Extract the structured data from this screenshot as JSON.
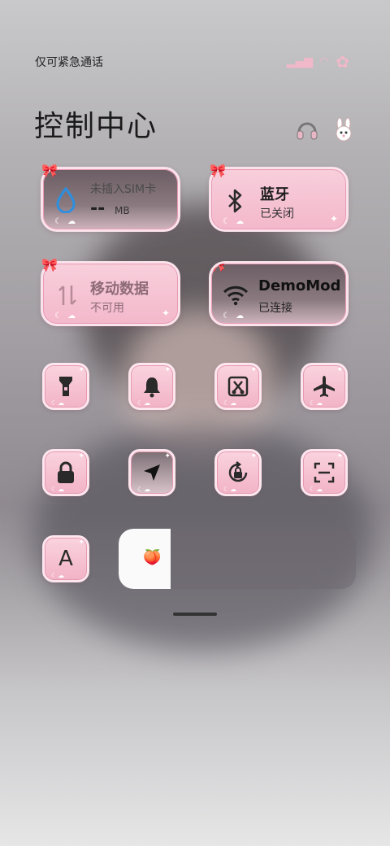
{
  "status": {
    "carrier_text": "仅可紧急通话"
  },
  "header": {
    "title": "控制中心"
  },
  "tiles": {
    "data_usage": {
      "title": "未插入SIM卡",
      "value": "--",
      "unit": "MB"
    },
    "bluetooth": {
      "title": "蓝牙",
      "status": "已关闭"
    },
    "mobile_data": {
      "title": "移动数据",
      "status": "不可用"
    },
    "wifi": {
      "title": "DemoMod",
      "status": "已连接"
    }
  },
  "quick_toggles": [
    {
      "name": "flashlight"
    },
    {
      "name": "bell"
    },
    {
      "name": "screenshot"
    },
    {
      "name": "airplane"
    },
    {
      "name": "lock"
    },
    {
      "name": "location"
    },
    {
      "name": "rotation-lock"
    },
    {
      "name": "scan"
    }
  ],
  "brightness": {
    "label": "A",
    "level": 0.22
  },
  "colors": {
    "tile_pink": "#f3b8cb",
    "text_dark": "#1b1b1b",
    "icon_dark": "#2a2a2a"
  }
}
